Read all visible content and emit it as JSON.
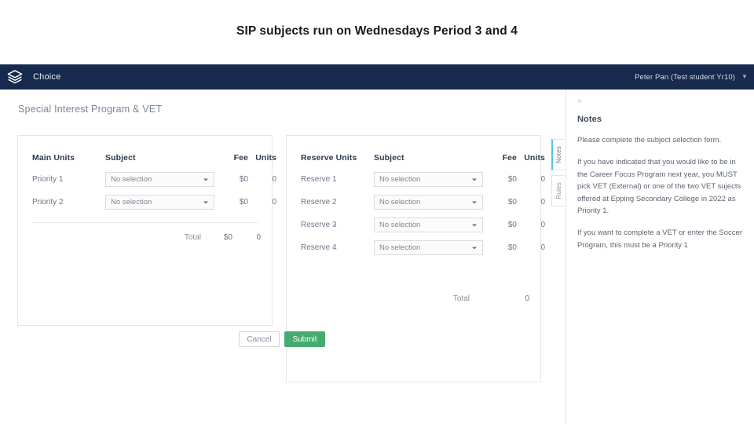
{
  "slide": {
    "title": "SIP subjects run on Wednesdays Period 3 and 4"
  },
  "appbar": {
    "logo_icon": "layers-stack-icon",
    "brand": "Choice",
    "user": "Peter Pan (Test student Yr10)",
    "caret_icon": "chevron-down-icon",
    "background": "#17294c"
  },
  "page": {
    "heading": "Special Interest Program & VET"
  },
  "main_units": {
    "headers": {
      "label": "Main Units",
      "subject": "Subject",
      "fee": "Fee",
      "units": "Units"
    },
    "rows": [
      {
        "label": "Priority 1",
        "subject": "No selection",
        "fee": "$0",
        "units": "0"
      },
      {
        "label": "Priority 2",
        "subject": "No selection",
        "fee": "$0",
        "units": "0"
      }
    ],
    "total": {
      "label": "Total",
      "fee": "$0",
      "units": "0"
    }
  },
  "reserve_units": {
    "headers": {
      "label": "Reserve Units",
      "subject": "Subject",
      "fee": "Fee",
      "units": "Units"
    },
    "rows": [
      {
        "label": "Reserve 1",
        "subject": "No selection",
        "fee": "$0",
        "units": "0"
      },
      {
        "label": "Reserve 2",
        "subject": "No selection",
        "fee": "$0",
        "units": "0"
      },
      {
        "label": "Reserve 3",
        "subject": "No selection",
        "fee": "$0",
        "units": "0"
      },
      {
        "label": "Reserve 4",
        "subject": "No selection",
        "fee": "$0",
        "units": "0"
      }
    ],
    "total": {
      "label": "Total",
      "fee": "",
      "units": "0"
    }
  },
  "actions": {
    "cancel": "Cancel",
    "submit": "Submit",
    "submit_color": "#45ab6f"
  },
  "side_tabs": {
    "notes": "Notes",
    "rules": "Rules",
    "active_accent": "#4fc3e8"
  },
  "notes": {
    "collapse_icon": "collapse-chevron-icon",
    "title": "Notes",
    "paragraphs": [
      "Please complete the subject selection form.",
      "If you have indicated that you would like to be in the Career Focus Program next year, you MUST pick VET (External) or one of the two VET sujects offered at Epping Secondary College in 2022 as Priority 1.",
      "If you want to complete a VET or enter the Soccer Program, this must be a Priority 1"
    ]
  }
}
